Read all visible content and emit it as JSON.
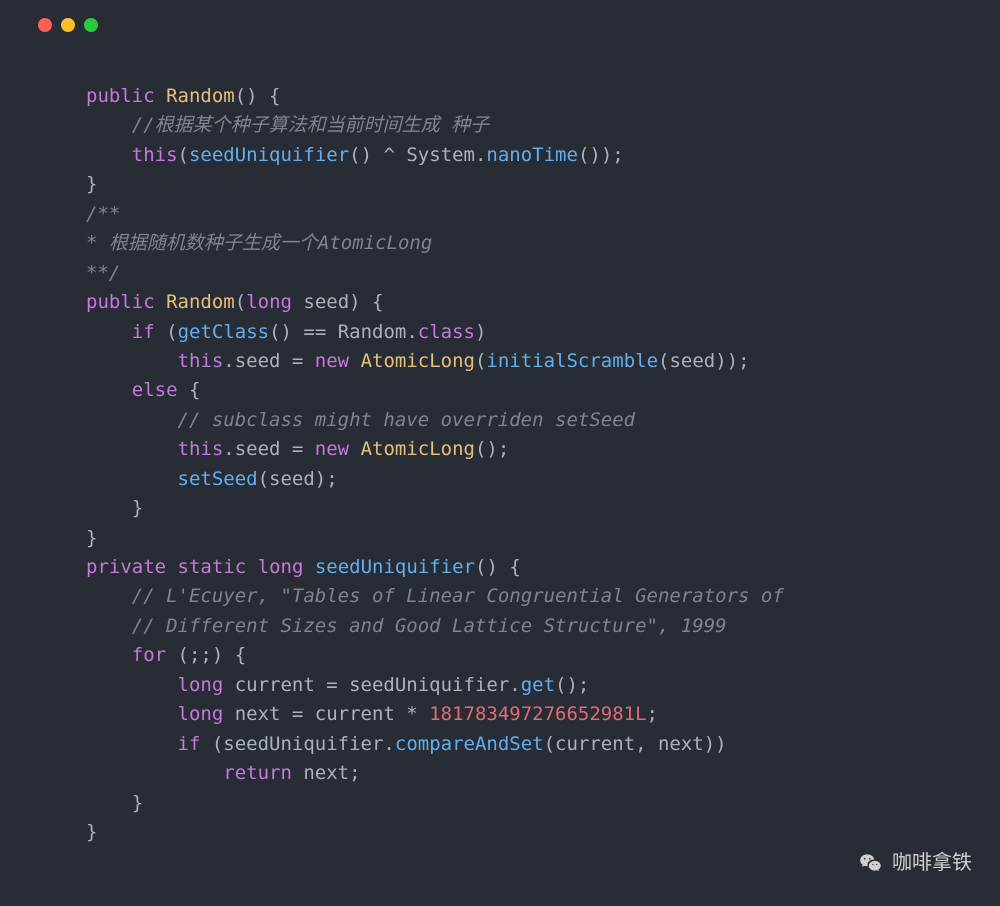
{
  "window": {
    "dots": [
      "red",
      "yellow",
      "green"
    ]
  },
  "colors": {
    "background": "#282c34",
    "keyword": "#c678dd",
    "type": "#e5c07b",
    "func": "#61afef",
    "comment": "#7f848e",
    "prop": "#e06c75",
    "number": "#e06c75",
    "default": "#abb2bf"
  },
  "code": {
    "l1_public": "public",
    "l1_random": "Random",
    "l1_rest": "() {",
    "l2_comment": "//根据某个种子算法和当前时间生成 种子",
    "l3_this": "this",
    "l3_seedUniq": "seedUniquifier",
    "l3_xor": "() ^ System.",
    "l3_nano": "nanoTime",
    "l3_end": "());",
    "l4": "}",
    "l5": "/**",
    "l6": "* 根据随机数种子生成一个AtomicLong",
    "l7": "**/",
    "l8_public": "public",
    "l8_random": "Random",
    "l8_long": "long",
    "l8_seed": " seed) {",
    "l9_if": "if",
    "l9_getclass": "getClass",
    "l9_eq": "() == Random.",
    "l9_class": "class",
    "l9_paren": ")",
    "l10_this": "this",
    "l10_seed": ".seed = ",
    "l10_new": "new",
    "l10_atomic": "AtomicLong",
    "l10_init": "initialScramble",
    "l10_end": "(seed));",
    "l11_else": "else",
    "l11_brace": " {",
    "l12_comment": "// subclass might have overriden setSeed",
    "l13_this": "this",
    "l13_seed": ".seed = ",
    "l13_new": "new",
    "l13_atomic": "AtomicLong",
    "l13_end": "();",
    "l14_setseed": "setSeed",
    "l14_end": "(seed);",
    "l15": "}",
    "l16": "}",
    "l17_private": "private",
    "l17_static": "static",
    "l17_long": "long",
    "l17_func": "seedUniquifier",
    "l17_end": "() {",
    "l18_comment": "// L'Ecuyer, \"Tables of Linear Congruential Generators of",
    "l19_comment": "// Different Sizes and Good Lattice Structure\", 1999",
    "l20_for": "for",
    "l20_end": " (;;) {",
    "l21_long": "long",
    "l21_cur": " current = seedUniquifier.",
    "l21_get": "get",
    "l21_end": "();",
    "l22_long": "long",
    "l22_next": " next = current * ",
    "l22_num": "181783497276652981L",
    "l22_end": ";",
    "l23_if": "if",
    "l23_seed": " (seedUniquifier.",
    "l23_cas": "compareAndSet",
    "l23_end": "(current, next))",
    "l24_return": "return",
    "l24_end": " next;",
    "l25": "}",
    "l26": "}"
  },
  "watermark": {
    "text": "咖啡拿铁"
  }
}
